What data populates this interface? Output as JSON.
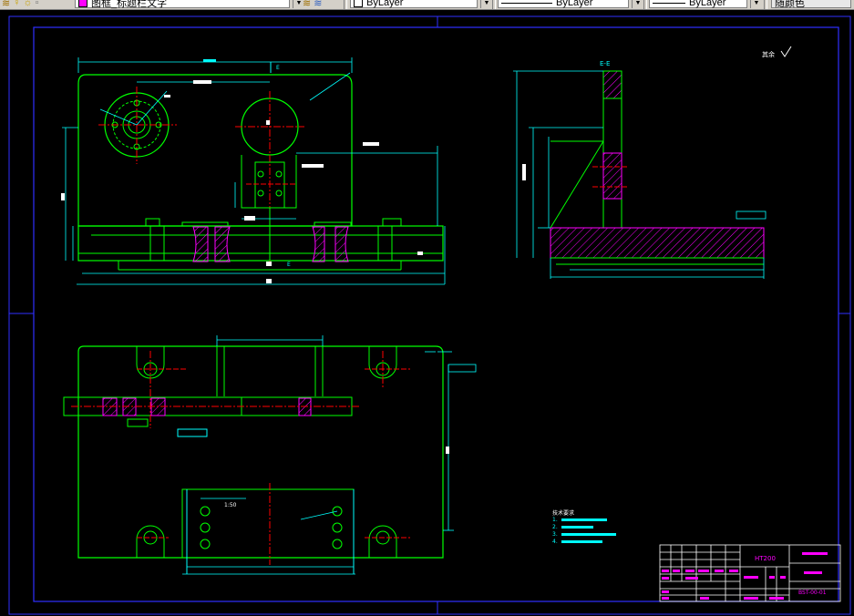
{
  "toolbar": {
    "layer_name": "图框_标题栏文字",
    "layer_color": "#ff00ff",
    "color_value": "ByLayer",
    "linetype_value": "ByLayer",
    "lineweight_value": "ByLayer",
    "plotstyle_value": "随颜色"
  },
  "drawing": {
    "section_label_top": "E-E",
    "section_marker_left": "E",
    "section_marker_right": "E",
    "scale_note": "1:50",
    "material": "HT200",
    "part_number": "BST-00-01",
    "roughness_note": "其余",
    "notes_title": "技术要求",
    "notes": [
      "1. ",
      "2. ",
      "3. ",
      "4. "
    ]
  }
}
